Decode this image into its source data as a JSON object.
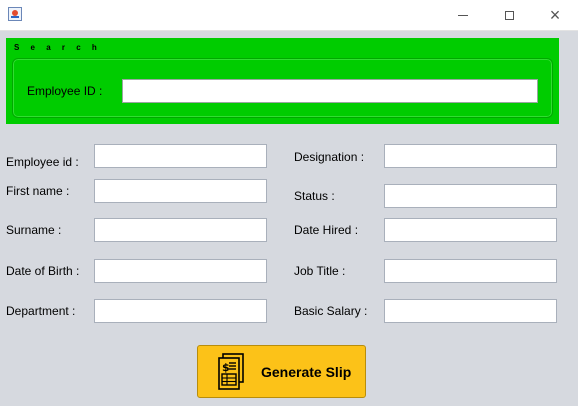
{
  "window": {
    "minimize_icon": "minimize-icon",
    "maximize_icon": "maximize-icon",
    "close_icon": "close-icon",
    "app_icon": "java-app-icon"
  },
  "search": {
    "title": "S e a r c h",
    "label": "Employee ID :",
    "value": ""
  },
  "form": {
    "left": [
      {
        "label": "Employee id :",
        "value": ""
      },
      {
        "label": "First name :",
        "value": ""
      },
      {
        "label": "Surname :",
        "value": ""
      },
      {
        "label": "Date of Birth :",
        "value": ""
      },
      {
        "label": "Department :",
        "value": ""
      }
    ],
    "right": [
      {
        "label": "Designation :",
        "value": ""
      },
      {
        "label": "Status :",
        "value": ""
      },
      {
        "label": "Date Hired :",
        "value": ""
      },
      {
        "label": "Job Title :",
        "value": ""
      },
      {
        "label": "Basic Salary :",
        "value": ""
      }
    ]
  },
  "actions": {
    "generate_label": "Generate Slip",
    "generate_icon": "salary-slip-icon"
  },
  "colors": {
    "search_panel": "#00cc00",
    "background": "#d6d9df",
    "button": "#fcc218"
  }
}
